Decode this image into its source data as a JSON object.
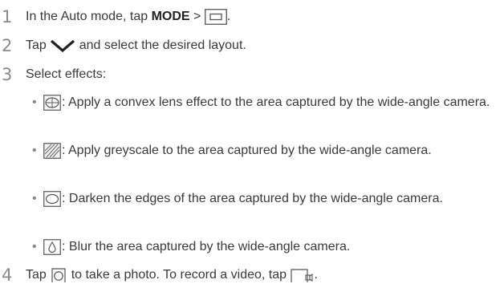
{
  "steps": [
    {
      "number": "1",
      "text_before": "In the Auto mode, tap ",
      "bold": "MODE",
      "text_after": " > ",
      "icon": "single-rectangle-icon",
      "tail": "."
    },
    {
      "number": "2",
      "text_before": "Tap ",
      "icon": "chevron-down-icon",
      "text_after": " and select the desired layout."
    },
    {
      "number": "3",
      "text": "Select effects:"
    },
    {
      "number": "4",
      "text_before": "Tap ",
      "icon": "camera-shutter-icon",
      "text_mid": " to take a photo. To record a video, tap ",
      "icon2": "video-record-icon",
      "tail": "."
    }
  ],
  "effects": [
    {
      "icon": "convex-lens-icon",
      "text": ": Apply a convex lens effect to the area captured by the wide-angle camera."
    },
    {
      "icon": "greyscale-icon",
      "text": ": Apply greyscale to the area captured by the wide-angle camera."
    },
    {
      "icon": "vignette-icon",
      "text": ": Darken the edges of the area captured by the wide-angle camera."
    },
    {
      "icon": "blur-icon",
      "text": ": Blur the area captured by the wide-angle camera."
    }
  ],
  "bullet_char": "•"
}
